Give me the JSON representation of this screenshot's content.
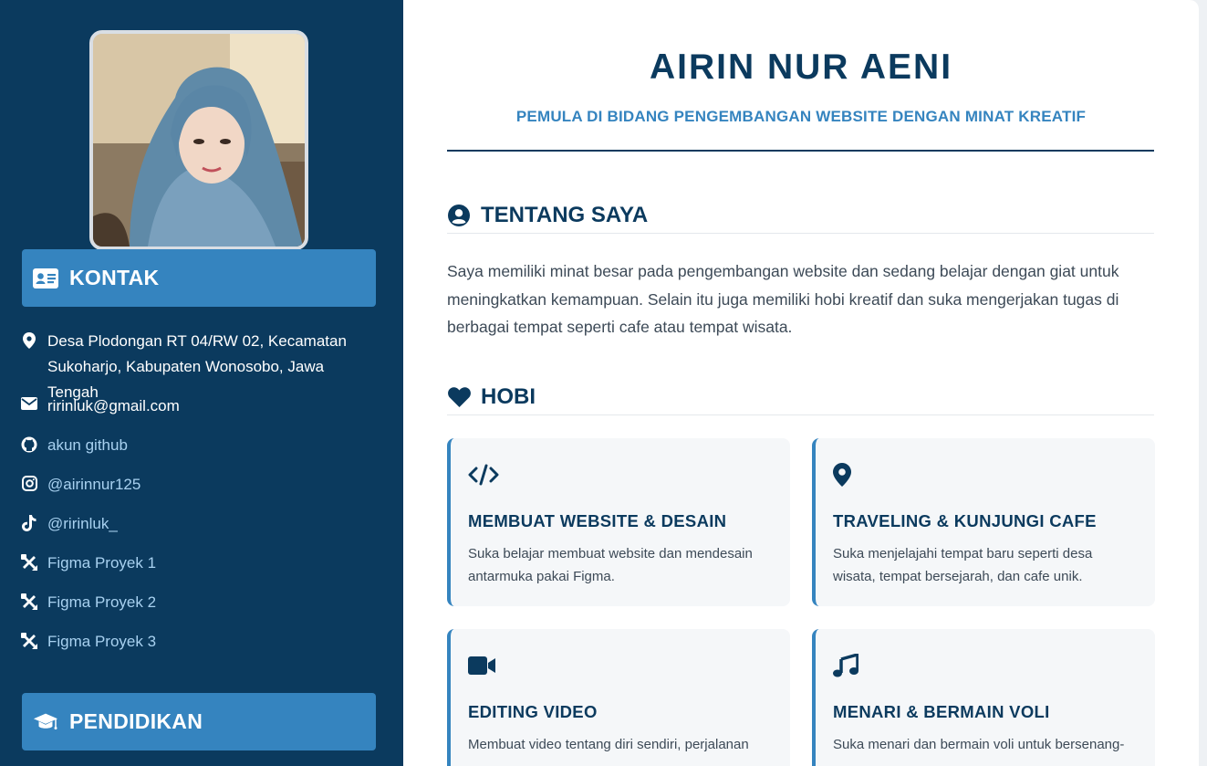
{
  "profile": {
    "name": "AIRIN NUR AENI",
    "subtitle": "PEMULA DI BIDANG PENGEMBANGAN WEBSITE DENGAN MINAT KREATIF"
  },
  "sidebar": {
    "contact_heading": "KONTAK",
    "contacts": [
      {
        "icon": "location-pin-icon",
        "text": "Desa Plodongan RT 04/RW 02, Kecamatan Sukoharjo, Kabupaten Wonosobo, Jawa Tengah",
        "link": false
      },
      {
        "icon": "envelope-icon",
        "text": "ririnluk@gmail.com",
        "link": false
      },
      {
        "icon": "github-icon",
        "text": "akun github",
        "link": true
      },
      {
        "icon": "instagram-icon",
        "text": "@airinnur125",
        "link": true
      },
      {
        "icon": "tiktok-icon",
        "text": "@ririnluk_",
        "link": true
      },
      {
        "icon": "figma-tools-icon",
        "text": "Figma Proyek 1",
        "link": true
      },
      {
        "icon": "figma-tools-icon",
        "text": "Figma Proyek 2",
        "link": true
      },
      {
        "icon": "figma-tools-icon",
        "text": "Figma Proyek 3",
        "link": true
      }
    ],
    "education_heading": "PENDIDIKAN"
  },
  "about": {
    "heading": "TENTANG SAYA",
    "icon": "user-circle-icon",
    "text": "Saya memiliki minat besar pada pengembangan website dan sedang belajar dengan giat untuk meningkatkan kemampuan. Selain itu juga memiliki hobi kreatif dan suka mengerjakan tugas di berbagai tempat seperti cafe atau tempat wisata."
  },
  "hobbies": {
    "heading": "HOBI",
    "icon": "heart-icon",
    "items": [
      {
        "icon": "code-icon",
        "title": "MEMBUAT WEBSITE & DESAIN",
        "desc": "Suka belajar membuat website dan mendesain antarmuka pakai Figma."
      },
      {
        "icon": "location-pin-icon",
        "title": "TRAVELING & KUNJUNGI CAFE",
        "desc": "Suka menjelajahi tempat baru seperti desa wisata, tempat bersejarah, dan cafe unik."
      },
      {
        "icon": "video-camera-icon",
        "title": "EDITING VIDEO",
        "desc": "Membuat video tentang diri sendiri, perjalanan"
      },
      {
        "icon": "music-note-icon",
        "title": "MENARI & BERMAIN VOLI",
        "desc": "Suka menari dan bermain voli untuk bersenang-"
      }
    ]
  },
  "colors": {
    "sidebar_bg": "#0b3a5e",
    "accent": "#3584bf",
    "link": "#a8d1f0",
    "card_bg": "#f5f7f9"
  }
}
